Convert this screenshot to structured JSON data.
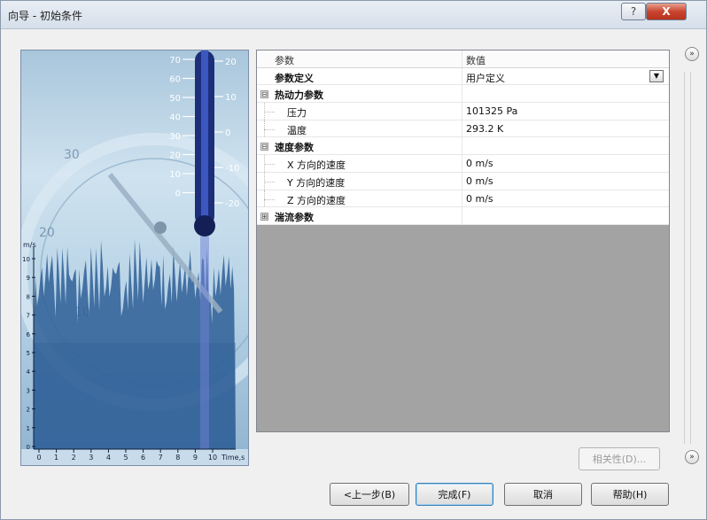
{
  "window": {
    "title": "向导 - 初始条件",
    "help_symbol": "?",
    "close_symbol": "X"
  },
  "grid": {
    "header": {
      "col1": "参数",
      "col2": "数值"
    },
    "rows": [
      {
        "kind": "plain",
        "label": "参数定义",
        "value": "用户定义",
        "has_dropdown": true
      },
      {
        "kind": "group",
        "label": "热动力参数",
        "expander": "⊟"
      },
      {
        "kind": "child",
        "label": "压力",
        "value": "101325 Pa"
      },
      {
        "kind": "child",
        "label": "温度",
        "value": "293.2 K"
      },
      {
        "kind": "group",
        "label": "速度参数",
        "expander": "⊟"
      },
      {
        "kind": "child",
        "label": "X 方向的速度",
        "value": "0 m/s"
      },
      {
        "kind": "child",
        "label": "Y 方向的速度",
        "value": "0 m/s"
      },
      {
        "kind": "child",
        "label": "Z 方向的速度",
        "value": "0 m/s"
      },
      {
        "kind": "group",
        "label": "湍流参数",
        "expander": "⊞"
      }
    ]
  },
  "hero_labels": {
    "celsius_ticks": [
      "70",
      "60",
      "50",
      "40",
      "30",
      "20",
      "10",
      "0"
    ],
    "fahrenheit_ticks": [
      "20",
      "10",
      "0",
      "-10",
      "-20"
    ],
    "y_unit": "m/s",
    "y_ticks": [
      "10",
      "9",
      "8",
      "7",
      "6",
      "5",
      "4",
      "3",
      "2",
      "1",
      "0"
    ],
    "x_ticks": [
      "0",
      "1",
      "2",
      "3",
      "4",
      "5",
      "6",
      "7",
      "8",
      "9",
      "10"
    ],
    "x_label": "Time,s",
    "dial_ticks": [
      "30",
      "20",
      "10"
    ]
  },
  "buttons": {
    "correlation": "相关性(D)...",
    "back": "<上一步(B)",
    "finish": "完成(F)",
    "cancel": "取消",
    "help": "帮助(H)"
  },
  "icons": {
    "collapse_chevron": "»",
    "dropdown_arrow": "▼"
  },
  "colors": {
    "title_gradient_top": "#e9eef5",
    "close_red": "#c9452f",
    "grid_empty": "#a3a3a3",
    "hero_blue": "#4f86b8"
  }
}
